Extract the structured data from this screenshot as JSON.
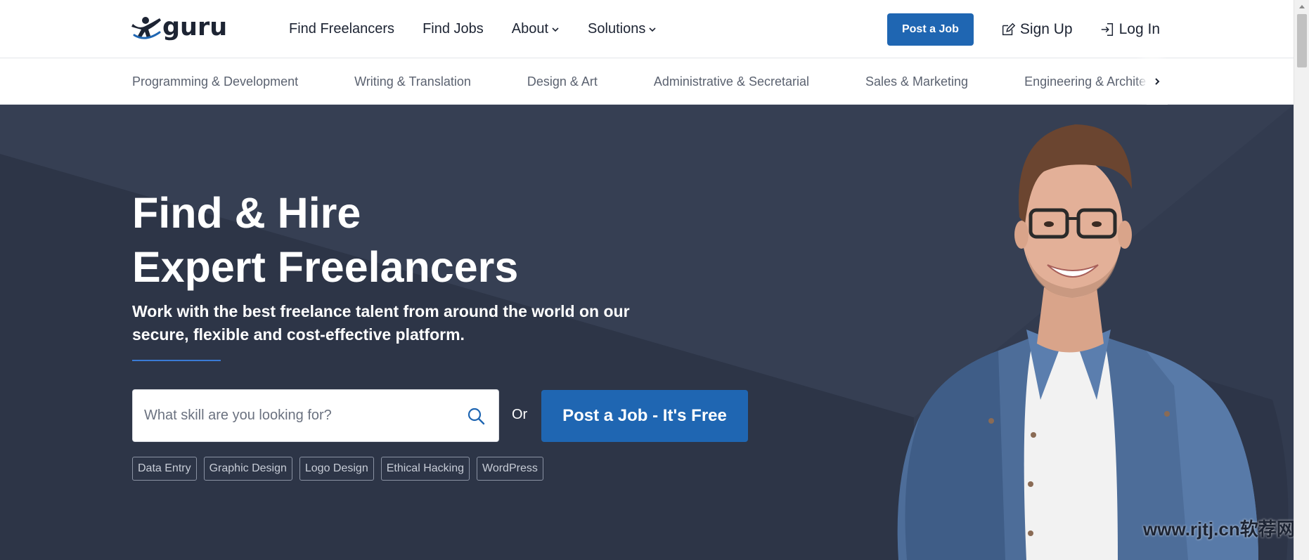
{
  "header": {
    "logo_text": "guru",
    "nav": [
      {
        "label": "Find Freelancers"
      },
      {
        "label": "Find Jobs"
      },
      {
        "label": "About"
      },
      {
        "label": "Solutions"
      }
    ],
    "post_job_label": "Post a Job",
    "sign_up_label": "Sign Up",
    "log_in_label": "Log In"
  },
  "categories": [
    "Programming & Development",
    "Writing & Translation",
    "Design & Art",
    "Administrative & Secretarial",
    "Sales & Marketing",
    "Engineering & Architecture"
  ],
  "hero": {
    "title_line1": "Find & Hire",
    "title_line2": "Expert Freelancers",
    "subtitle": "Work with the best freelance talent from around the world on our secure, flexible and cost-effective platform.",
    "search_placeholder": "What skill are you looking for?",
    "or_label": "Or",
    "cta_label": "Post a Job - It's Free",
    "tags": [
      "Data Entry",
      "Graphic Design",
      "Logo Design",
      "Ethical Hacking",
      "WordPress"
    ]
  },
  "watermark": "www.rjtj.cn软荐网",
  "colors": {
    "brand_blue": "#1f66b2",
    "hero_bg": "#323b4f",
    "text_dark": "#1d2433"
  },
  "icons": {
    "logo": "guru-logo-icon",
    "search": "search-icon",
    "sign_up": "edit-icon",
    "log_in": "login-icon",
    "next": "chevron-right-icon"
  }
}
